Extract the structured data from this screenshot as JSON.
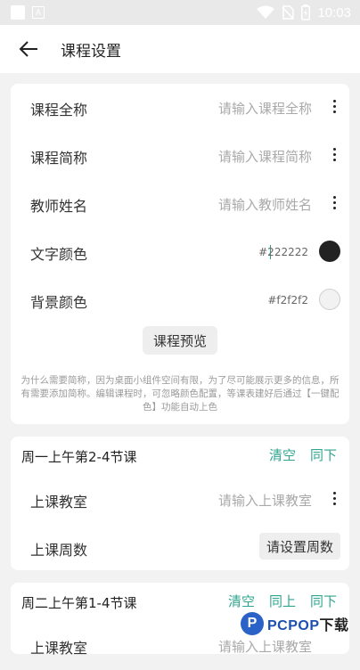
{
  "status_bar": {
    "time": "10:03"
  },
  "top_bar": {
    "title": "课程设置"
  },
  "course_form": {
    "full_name": {
      "label": "课程全称",
      "placeholder": "请输入课程全称"
    },
    "short_name": {
      "label": "课程简称",
      "placeholder": "请输入课程简称"
    },
    "teacher": {
      "label": "教师姓名",
      "placeholder": "请输入教师姓名"
    },
    "text_color": {
      "label": "文字颜色",
      "value": "#222222",
      "swatch": "#222222"
    },
    "bg_color": {
      "label": "背景颜色",
      "value": "#f2f2f2",
      "swatch": "#f2f2f2"
    },
    "preview_button": "课程预览",
    "note": "为什么需要简称，因为桌面小组件空间有限，为了尽可能展示更多的信息，所有需要添加简称。编辑课程时，可忽略颜色配置，等课表建好后通过【一键配色】功能自动上色"
  },
  "sections": [
    {
      "title": "周一上午第2-4节课",
      "actions": [
        "清空",
        "同下"
      ],
      "classroom": {
        "label": "上课教室",
        "placeholder": "请输入上课教室"
      },
      "weeks": {
        "label": "上课周数",
        "button": "请设置周数"
      }
    },
    {
      "title": "周二上午第1-4节课",
      "actions": [
        "清空",
        "同上",
        "同下"
      ],
      "classroom": {
        "label": "上课教室",
        "placeholder": "请输入上课教室"
      }
    }
  ],
  "colors": {
    "accent": "#2fa58f",
    "background": "#f2f2f2",
    "card": "#ffffff"
  },
  "watermark": {
    "brand": "PCPOP",
    "suffix": "下载"
  }
}
